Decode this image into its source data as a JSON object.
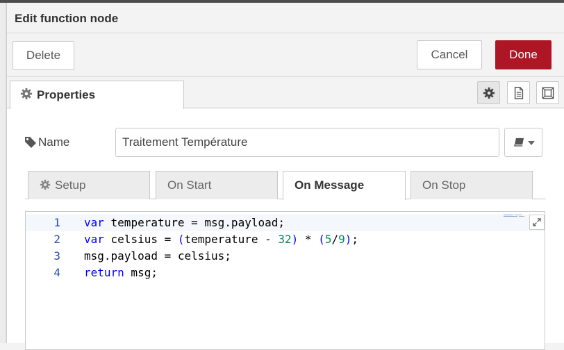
{
  "dialog": {
    "title": "Edit function node"
  },
  "toolbar": {
    "delete_label": "Delete",
    "cancel_label": "Cancel",
    "done_label": "Done"
  },
  "tabs": {
    "properties_label": "Properties"
  },
  "tab_icons": [
    "gear-icon",
    "document-icon",
    "frame-icon"
  ],
  "name_field": {
    "label": "Name",
    "value": "Traitement Température"
  },
  "subtabs": [
    {
      "label": "Setup",
      "icon": "gear-icon"
    },
    {
      "label": "On Start"
    },
    {
      "label": "On Message",
      "active": true
    },
    {
      "label": "On Stop"
    }
  ],
  "editor": {
    "lines": [
      {
        "number": "1",
        "code": "var temperature = msg.payload;"
      },
      {
        "number": "2",
        "code": "var celsius = (temperature - 32) * (5/9);"
      },
      {
        "number": "3",
        "code": "msg.payload = celsius;"
      },
      {
        "number": "4",
        "code": "return msg;"
      }
    ]
  },
  "colors": {
    "done": "#ad1625",
    "keyword": "#0000ff",
    "number": "#098658",
    "line_number": "#2a4fb0"
  }
}
